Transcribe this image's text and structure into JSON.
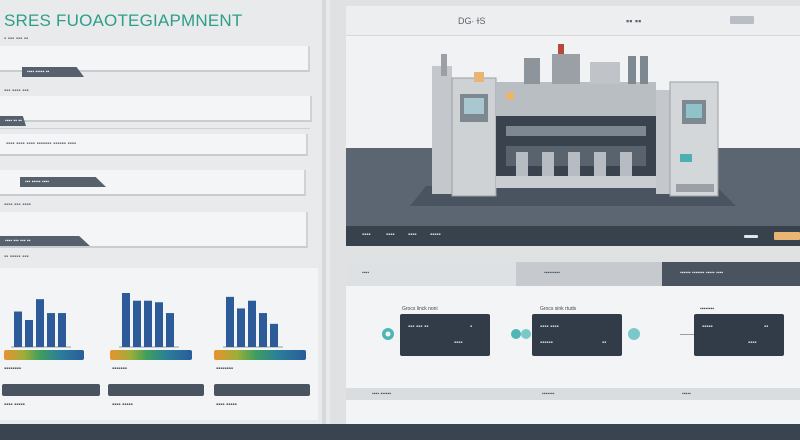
{
  "app": {
    "title": "SRES FUOAOTEGIAPMNENT"
  },
  "left": {
    "rows": [
      {
        "text": "▪ ▪▪▪ ▪▪▪ ▪▪",
        "tag": "▪▪▪▪ ▪▪▪▪▪ ▪▪"
      },
      {
        "text": "▪▪▪ ▪▪▪▪ ▪▪▪",
        "tag": "▪▪▪▪ ▪▪ ▪▪"
      },
      {
        "text": "▪▪▪▪ ▪▪▪▪ ▪▪▪▪   ▪▪▪▪▪▪▪ ▪▪▪▪▪▪ ▪▪▪▪",
        "tag": "▪▪▪ ▪▪▪▪▪ ▪▪▪▪"
      },
      {
        "text": "▪▪▪▪ ▪▪▪ ▪▪▪▪",
        "tag": "▪▪▪▪ ▪▪▪ ▪▪▪ ▪▪"
      }
    ],
    "section_label": "▪▪ ▪▪▪▪▪ ▪▪▪",
    "charts": [
      {
        "values": [
          46,
          35,
          62,
          44,
          44
        ],
        "label": "▪▪▪▪▪▪▪▪",
        "caption": "▪▪▪▪ ▪▪▪▪▪"
      },
      {
        "values": [
          70,
          60,
          60,
          58,
          44
        ],
        "label": "▪▪▪▪▪▪▪",
        "caption": "▪▪▪▪ ▪▪▪▪▪"
      },
      {
        "values": [
          65,
          50,
          60,
          44,
          30
        ],
        "label": "▪▪▪▪▪▪▪▪",
        "caption": "▪▪▪▪ ▪▪▪▪▪"
      }
    ]
  },
  "viewer": {
    "header_text": "DG∙ ɫS",
    "header_text2": "▪▪  ▪▪",
    "footer_items": [
      "▪▪▪▪",
      "▪▪▪▪",
      "▪▪▪▪",
      "▪▪▪▪▪"
    ],
    "colors": {
      "accent": "#e8b575",
      "floor": "#5b6672",
      "machine": "#c3c6ca"
    }
  },
  "lower": {
    "tabs": [
      "▪▪▪▪",
      "▪▪▪▪▪▪▪▪▪",
      "▪▪▪▪▪▪ ▪▪▪▪▪▪▪ ▪▪▪▪▪ ▪▪▪▪"
    ],
    "cards": [
      {
        "title": "Grocs linck noni",
        "text": "▪▪▪ ▪▪▪ ▪▪",
        "sub": "▪▪▪▪",
        "mark": "▪"
      },
      {
        "title": "Grocs sink rtuds",
        "text": "▪▪▪▪ ▪▪▪▪",
        "sub": "▪▪▪▪▪▪",
        "mark": "▪▪"
      },
      {
        "title": "▪▪▪▪▪▪▪▪",
        "text": "▪▪▪▪▪",
        "sub": "▪▪▪▪",
        "mark": "▪▪"
      }
    ],
    "footer_items": [
      "▪▪▪▪ ▪▪▪▪▪▪",
      "▪▪▪▪▪▪▪",
      "▪▪▪▪▪"
    ]
  }
}
